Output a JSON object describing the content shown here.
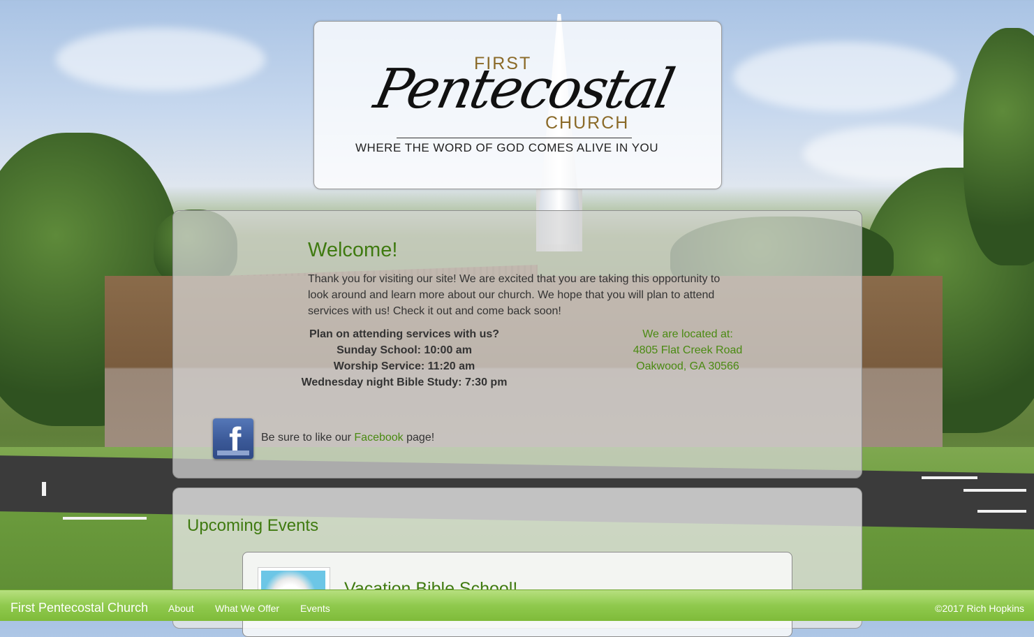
{
  "logo": {
    "first": "FIRST",
    "pentecostal": "Pentecostal",
    "church": "CHURCH",
    "tagline": "WHERE THE WORD OF GOD COMES ALIVE IN YOU"
  },
  "welcome": {
    "title": "Welcome!",
    "text": "Thank you for visiting our site! We are excited that you are taking this opportunity to look around and learn more about our church. We hope that you will plan to attend services with us! Check it out and come back soon!",
    "services": [
      "Plan on attending services with us?",
      "Sunday School: 10:00 am",
      "Worship Service: 11:20 am",
      "Wednesday night Bible Study: 7:30 pm"
    ],
    "location": [
      "We are located at:",
      "4805 Flat Creek Road",
      "Oakwood, GA 30566"
    ],
    "facebook_prefix": "Be sure to like our ",
    "facebook_link": "Facebook",
    "facebook_suffix": " page!",
    "facebook_icon_glyph": "f"
  },
  "events": {
    "title": "Upcoming Events",
    "items": [
      {
        "title": "Vacation Bible School!"
      }
    ]
  },
  "footer": {
    "brand": "First Pentecostal Church",
    "nav": [
      "About",
      "What We Offer",
      "Events"
    ],
    "copyright": "©2017 Rich Hopkins"
  },
  "colors": {
    "accent_green": "#3f7a10",
    "footer_green": "#8fc94d",
    "facebook_blue": "#3b5998"
  }
}
